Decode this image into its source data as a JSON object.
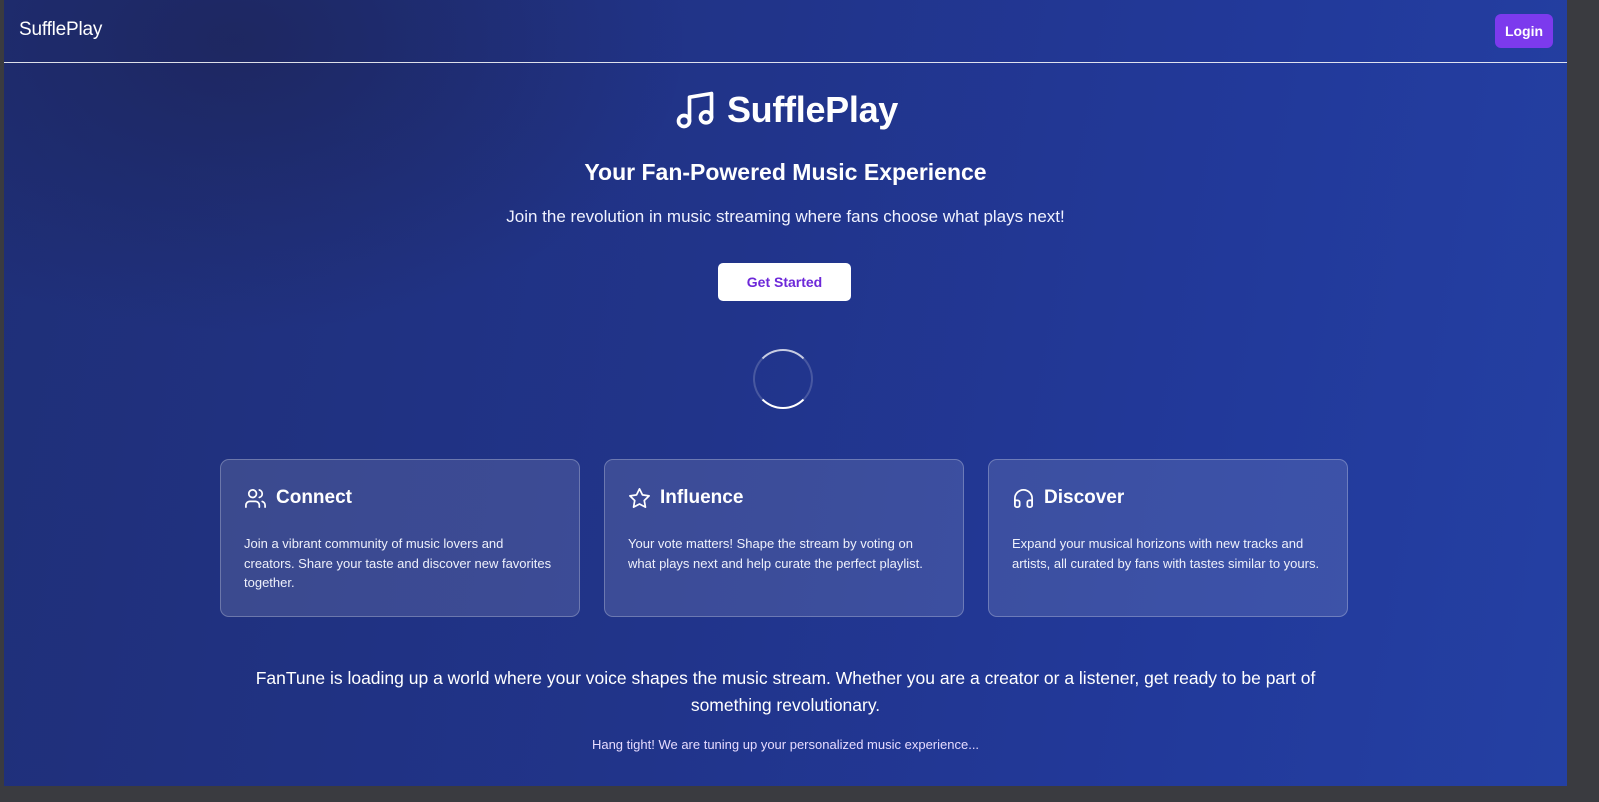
{
  "nav": {
    "brand": "SufflePlay",
    "login_label": "Login"
  },
  "hero": {
    "icon": "music-note-icon",
    "title": "SufflePlay",
    "tagline": "Your Fan-Powered Music Experience",
    "subtitle": "Join the revolution in music streaming where fans choose what plays next!",
    "cta_label": "Get Started"
  },
  "features": [
    {
      "icon": "users-icon",
      "title": "Connect",
      "text": "Join a vibrant community of music lovers and creators. Share your taste and discover new favorites together."
    },
    {
      "icon": "star-icon",
      "title": "Influence",
      "text": "Your vote matters! Shape the stream by voting on what plays next and help curate the perfect playlist."
    },
    {
      "icon": "headphones-icon",
      "title": "Discover",
      "text": "Expand your musical horizons with new tracks and artists, all curated by fans with tastes similar to yours."
    }
  ],
  "footer": {
    "message": "FanTune is loading up a world where your voice shapes the music stream. Whether you are a creator or a listener, get ready to be part of something revolutionary.",
    "hang_tight": "Hang tight! We are tuning up your personalized music experience..."
  },
  "colors": {
    "background_start": "#1f2f78",
    "background_end": "#2440a3",
    "accent": "#7c3aed",
    "cta_text": "#6d28d9"
  }
}
